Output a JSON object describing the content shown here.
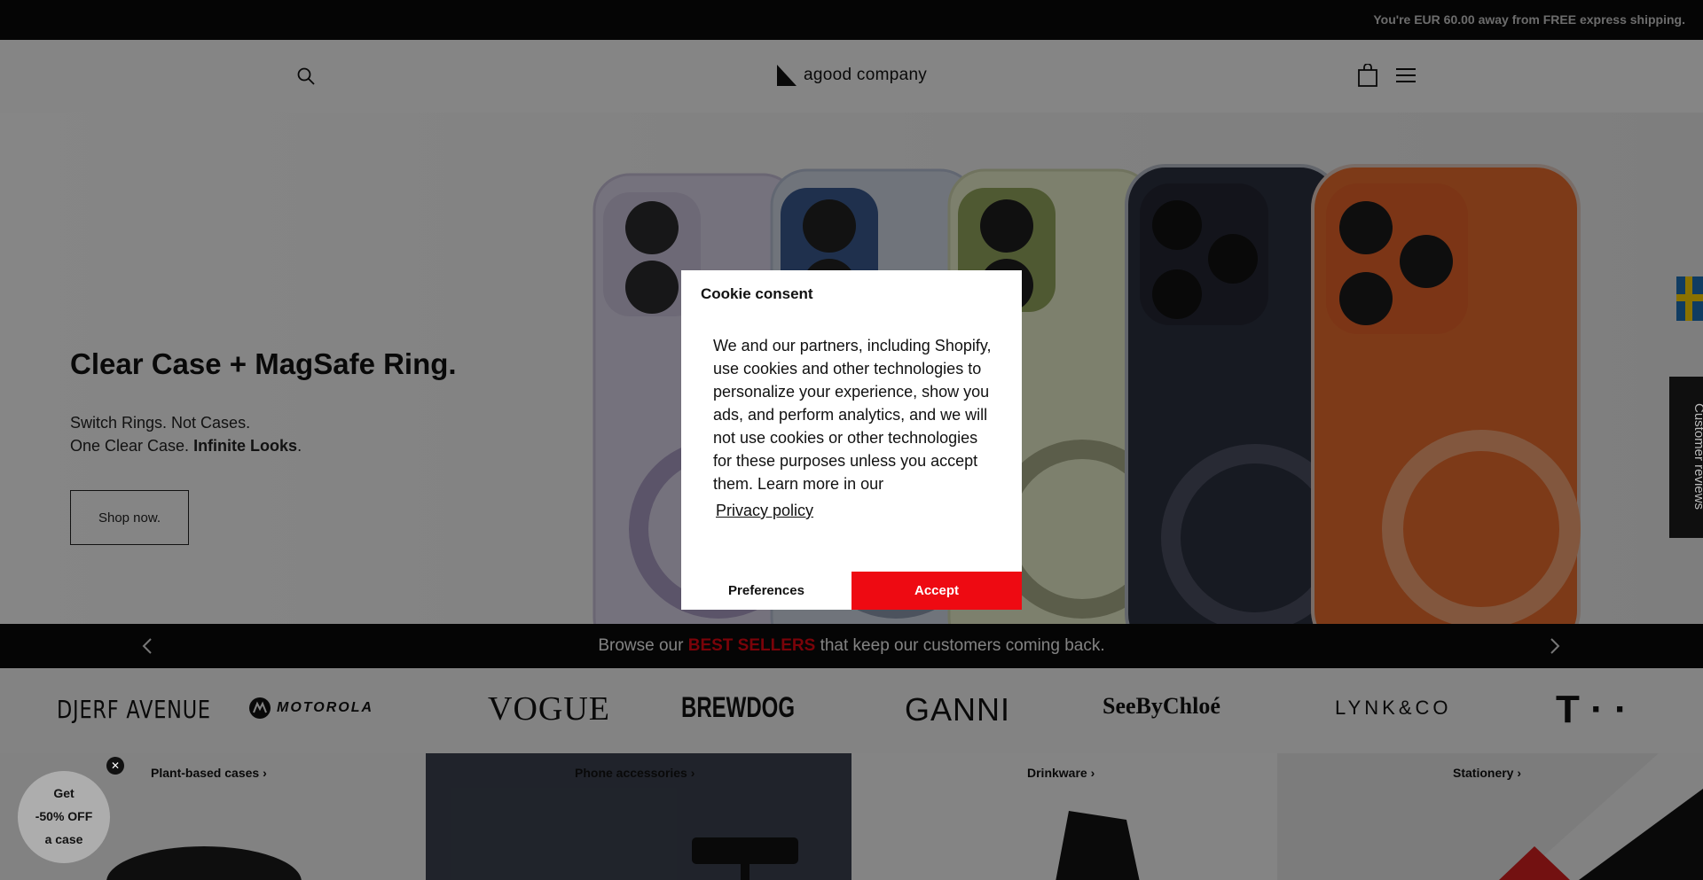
{
  "topbar": {
    "shipping_message": "You're EUR 60.00 away from FREE express shipping."
  },
  "header": {
    "logo_text": "agood company",
    "icons": [
      "search-icon",
      "shopping-bag-icon",
      "hamburger-menu-icon"
    ]
  },
  "hero": {
    "title": "Clear Case + MagSafe Ring.",
    "subtitle_line1": "Switch Rings. Not Cases.",
    "subtitle_line2_prefix": "One Clear Case. ",
    "subtitle_line2_bold": "Infinite Looks",
    "subtitle_line2_suffix": ".",
    "cta_label": "Shop now."
  },
  "promo": {
    "text_prefix": "Browse our ",
    "highlight": "BEST SELLERS",
    "text_suffix": " that keep our customers coming back.",
    "highlight_color": "#e10612"
  },
  "brands": [
    "DJERF AVENUE",
    "MOTOROLA",
    "VOGUE",
    "BREWDOG",
    "GANNI",
    "SeeByChloé",
    "LYNK&CO",
    "T · ·"
  ],
  "categories": [
    {
      "label": "Plant-based cases",
      "arrow": "›"
    },
    {
      "label": "Phone accessories",
      "arrow": "›"
    },
    {
      "label": "Drinkware",
      "arrow": "›"
    },
    {
      "label": "Stationery",
      "arrow": "›"
    }
  ],
  "cookie": {
    "title": "Cookie consent",
    "body": "We and our partners, including Shopify, use cookies and other technologies to personalize your experience, show you ads, and perform analytics, and we will not use cookies or other technologies for these purposes unless you accept them. Learn more in our",
    "policy_link": "Privacy policy",
    "preferences_label": "Preferences",
    "accept_label": "Accept",
    "accept_color": "#ee0a12"
  },
  "reviews_tab": {
    "label": "Customer reviews"
  },
  "discount": {
    "line1": " Get",
    "line2": "-50% OFF",
    "line3": "a case",
    "close": "✕"
  }
}
